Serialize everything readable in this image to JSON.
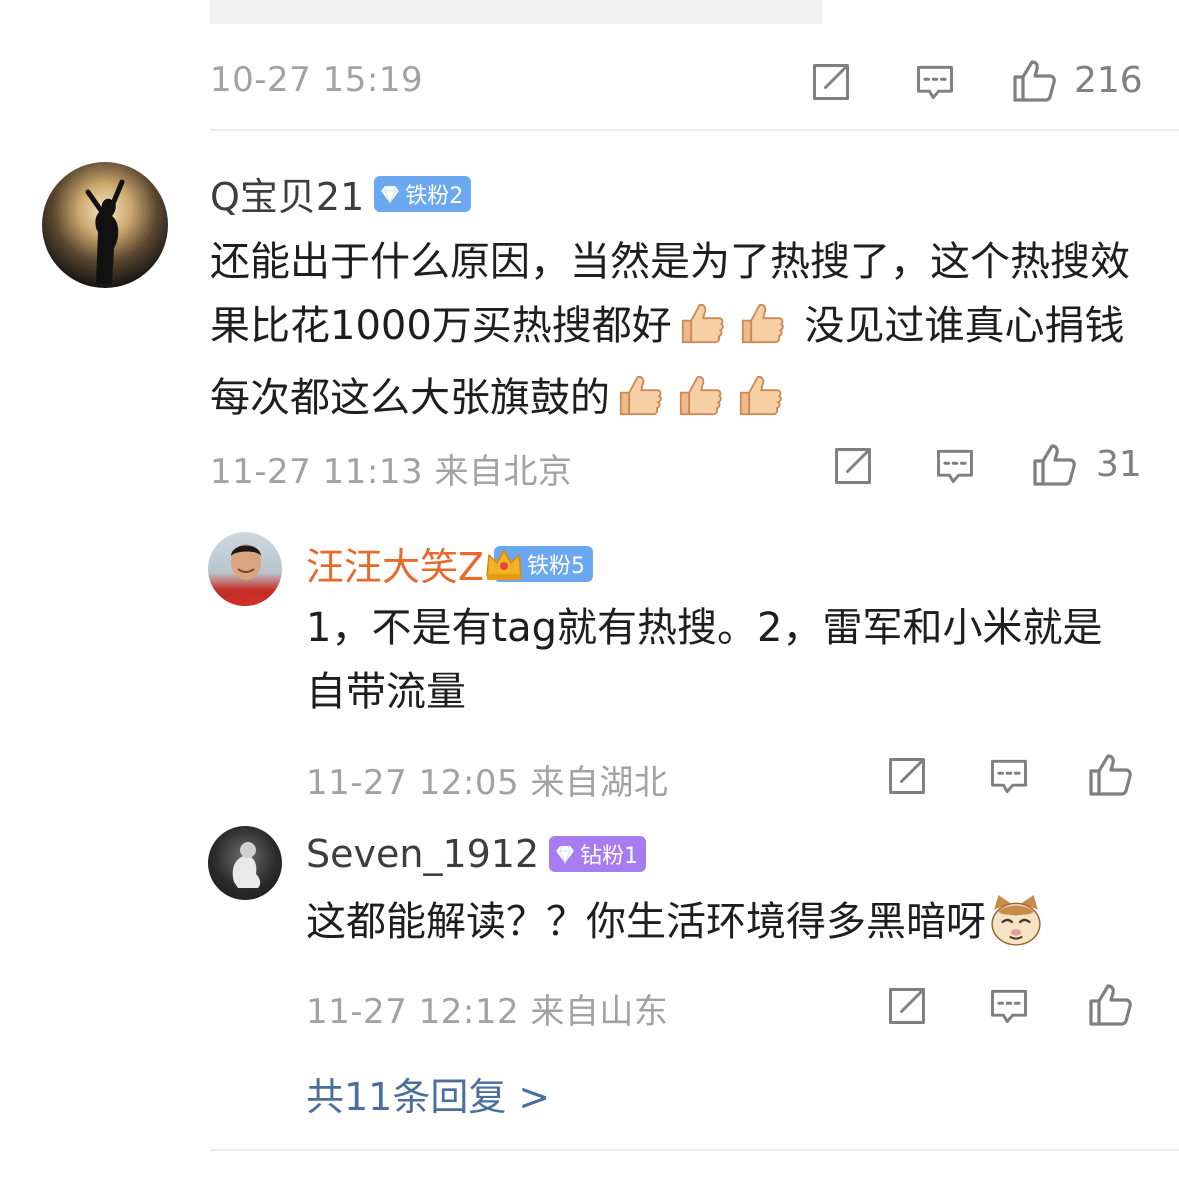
{
  "top_comment": {
    "timestamp": "10-27 15:19",
    "likes": "216"
  },
  "comment": {
    "username": "Q宝贝21",
    "badge": "铁粉2",
    "text_part1": "还能出于什么原因，当然是为了热搜了，这个热搜效果比花1000万买热搜都好",
    "text_part2": "没见过谁真心捐钱每次都这么大张旗鼓的",
    "timestamp": "11-27 11:13",
    "location": "来自北京",
    "likes": "31"
  },
  "replies": [
    {
      "username": "汪汪大笑Z",
      "badge": "铁粉5",
      "text": "1，不是有tag就有热搜。2，雷军和小米就是自带流量",
      "timestamp": "11-27 12:05",
      "location": "来自湖北"
    },
    {
      "username": "Seven_1912",
      "badge": "钻粉1",
      "text": "这都能解读？？你生活环境得多黑暗呀",
      "timestamp": "11-27 12:12",
      "location": "来自山东"
    }
  ],
  "more_replies": "共11条回复 >",
  "colors": {
    "reply_username": "#e8692c",
    "more_link": "#4a6f9e",
    "badge_iron": "#6aa8f0",
    "badge_diamond": "#a67cf0"
  },
  "icons": [
    "repost-icon",
    "comment-icon",
    "like-icon",
    "thumbs-up-emoji",
    "cat-emoji",
    "diamond-icon",
    "crown-icon"
  ]
}
